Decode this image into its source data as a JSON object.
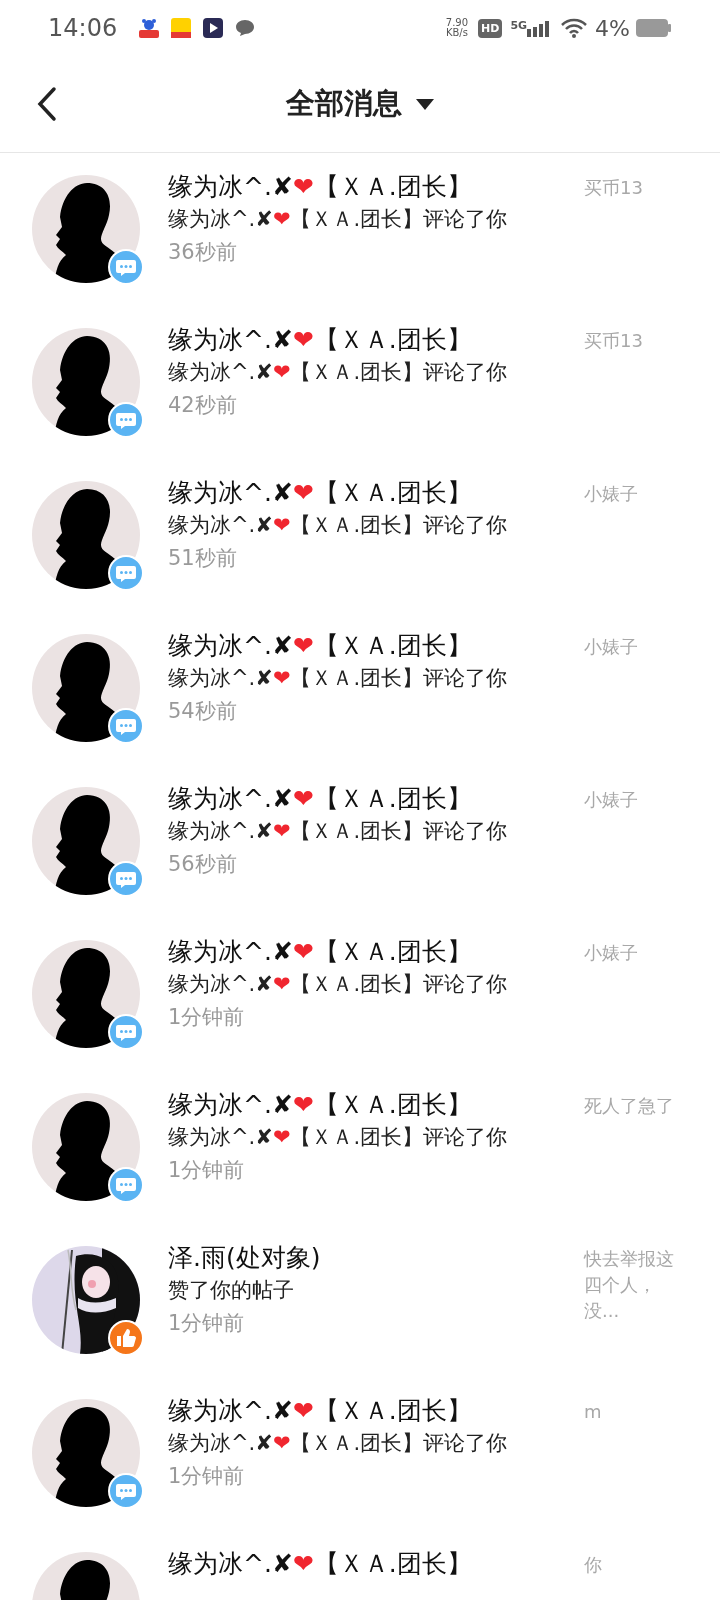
{
  "status_bar": {
    "time": "14:06",
    "net_speed": [
      "7.90",
      "KB/s"
    ],
    "hd": "HD",
    "network": "5G",
    "battery": "4%"
  },
  "header": {
    "title": "全部消息"
  },
  "messages": [
    {
      "avatar": {
        "kind": "silhouette"
      },
      "kind": "comment",
      "name": "缘为冰^.✘❤【ＸＡ.团长】",
      "text": "缘为冰^.✘❤【ＸＡ.团长】评论了你",
      "time": "36秒前",
      "side": "买币13"
    },
    {
      "avatar": {
        "kind": "silhouette"
      },
      "kind": "comment",
      "name": "缘为冰^.✘❤【ＸＡ.团长】",
      "text": "缘为冰^.✘❤【ＸＡ.团长】评论了你",
      "time": "42秒前",
      "side": "买币13"
    },
    {
      "avatar": {
        "kind": "silhouette"
      },
      "kind": "comment",
      "name": "缘为冰^.✘❤【ＸＡ.团长】",
      "text": "缘为冰^.✘❤【ＸＡ.团长】评论了你",
      "time": "51秒前",
      "side": "小婊子"
    },
    {
      "avatar": {
        "kind": "silhouette"
      },
      "kind": "comment",
      "name": "缘为冰^.✘❤【ＸＡ.团长】",
      "text": "缘为冰^.✘❤【ＸＡ.团长】评论了你",
      "time": "54秒前",
      "side": "小婊子"
    },
    {
      "avatar": {
        "kind": "silhouette"
      },
      "kind": "comment",
      "name": "缘为冰^.✘❤【ＸＡ.团长】",
      "text": "缘为冰^.✘❤【ＸＡ.团长】评论了你",
      "time": "56秒前",
      "side": "小婊子"
    },
    {
      "avatar": {
        "kind": "silhouette"
      },
      "kind": "comment",
      "name": "缘为冰^.✘❤【ＸＡ.团长】",
      "text": "缘为冰^.✘❤【ＸＡ.团长】评论了你",
      "time": "1分钟前",
      "side": "小婊子"
    },
    {
      "avatar": {
        "kind": "silhouette"
      },
      "kind": "comment",
      "name": "缘为冰^.✘❤【ＸＡ.团长】",
      "text": "缘为冰^.✘❤【ＸＡ.团长】评论了你",
      "time": "1分钟前",
      "side": "死人了急了"
    },
    {
      "kind": "like",
      "name": "泽.雨(处对象)",
      "text": "赞了你的帖子",
      "time": "1分钟前",
      "side": "快去举报这四个人，没..."
    },
    {
      "avatar": {
        "kind": "silhouette"
      },
      "kind": "comment",
      "name": "缘为冰^.✘❤【ＸＡ.团长】",
      "text": "缘为冰^.✘❤【ＸＡ.团长】评论了你",
      "time": "1分钟前",
      "side": "m"
    },
    {
      "avatar": {
        "kind": "silhouette"
      },
      "name": "缘为冰^.✘❤【ＸＡ.团长】",
      "side": "你"
    }
  ]
}
